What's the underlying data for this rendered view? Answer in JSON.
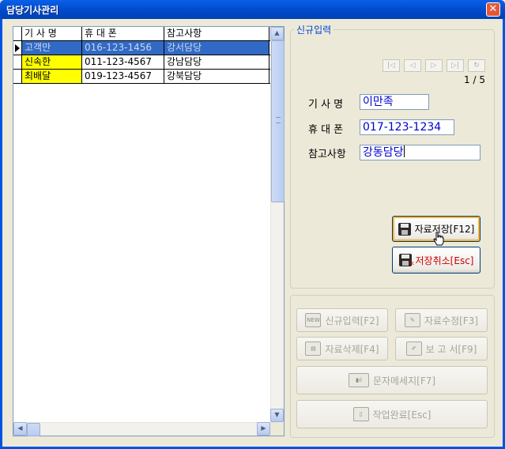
{
  "window": {
    "title": "담당기사관리",
    "close": "✕"
  },
  "grid": {
    "columns": [
      "기 사 명",
      "휴 대 폰",
      "참고사항"
    ],
    "rows": [
      {
        "name": "고객만",
        "phone": "016-123-1456",
        "note": "강서담당",
        "selected": true
      },
      {
        "name": "신속한",
        "phone": "011-123-4567",
        "note": "강남담당",
        "selected": false
      },
      {
        "name": "최배달",
        "phone": "019-123-4567",
        "note": "강북담당",
        "selected": false
      }
    ]
  },
  "entry": {
    "group_title": "신규입력",
    "pager": "1 / 5",
    "nav": [
      "|◁",
      "◁",
      "▷",
      "▷|",
      "↻"
    ],
    "name_label": "기 사 명",
    "name_value": "이만족",
    "phone_label": "휴 대 폰",
    "phone_value": "017-123-1234",
    "note_label": "참고사항",
    "note_value": "강동담당",
    "save_label": "자료저장[F12]",
    "cancel_label": "저장취소[Esc]"
  },
  "actions": {
    "new_label": "신규입력[F2]",
    "new_badge": "NEW",
    "edit_label": "자료수정[F3]",
    "delete_label": "자료삭제[F4]",
    "report_label": "보 고 서[F9]",
    "sms_label": "문자메세지[F7]",
    "done_label": "작업완료[Esc]"
  }
}
